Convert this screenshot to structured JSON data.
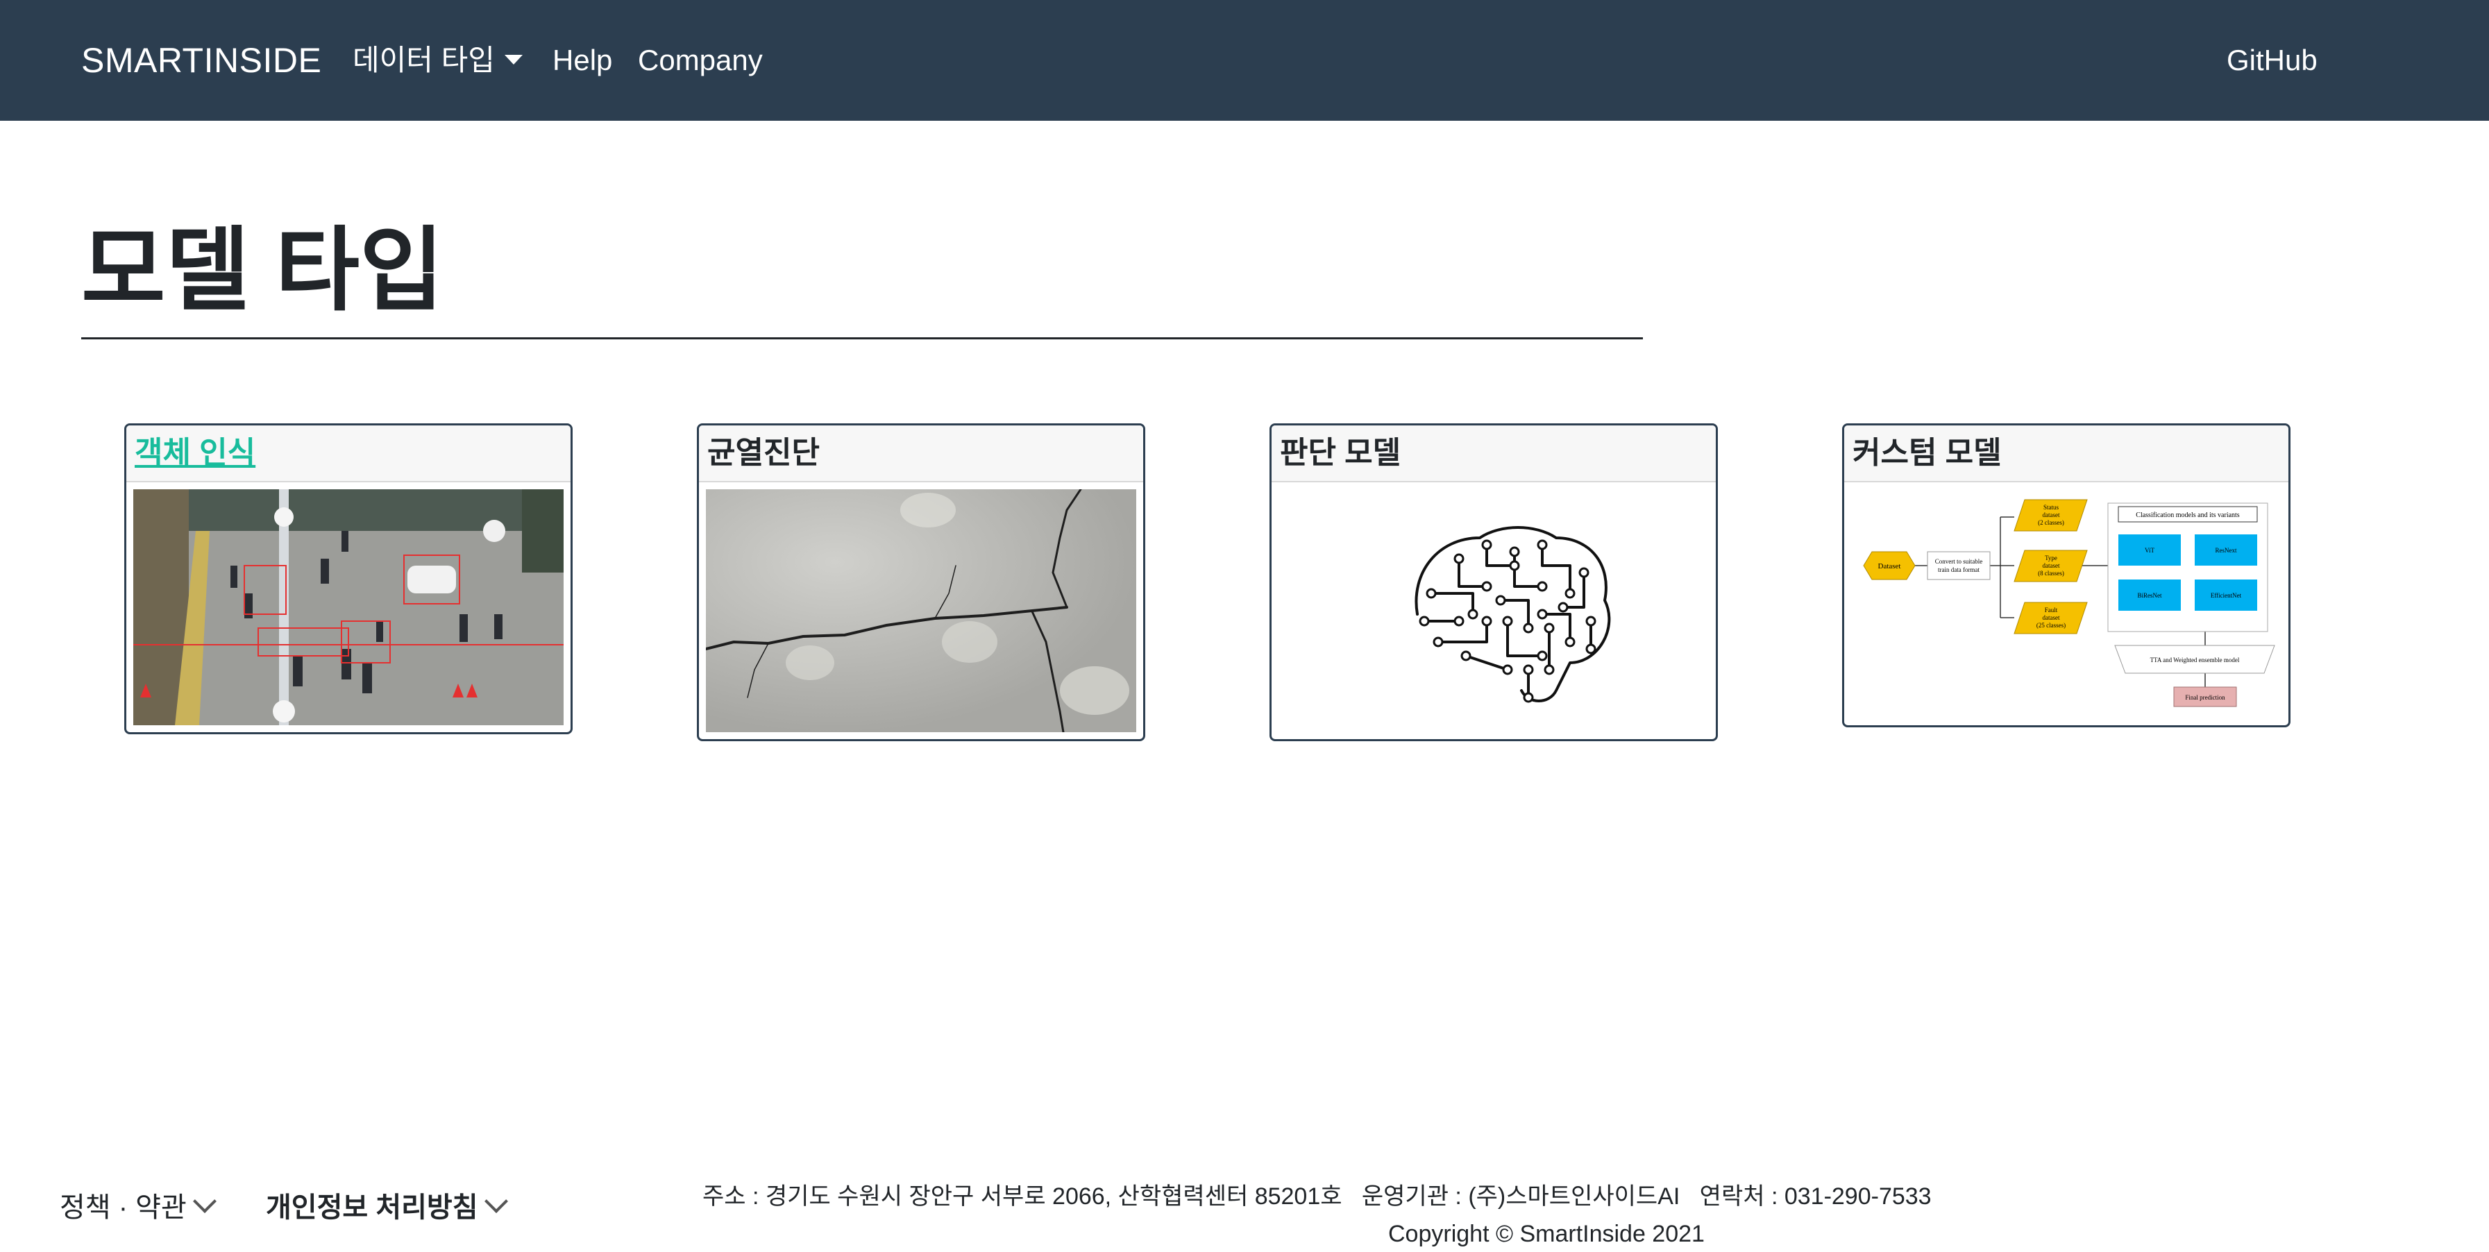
{
  "navbar": {
    "brand": "SMARTINSIDE",
    "dropdown_label": "데이터 타입",
    "help": "Help",
    "company": "Company",
    "github": "GitHub"
  },
  "page": {
    "title": "모델 타입"
  },
  "cards": [
    {
      "title": "객체 인식",
      "image": "object-detection-street-photo"
    },
    {
      "title": "균열진단",
      "image": "concrete-crack-photo"
    },
    {
      "title": "판단 모델",
      "image": "circuit-brain-icon"
    },
    {
      "title": "커스텀 모델",
      "image": "classification-pipeline-diagram"
    }
  ],
  "diagram": {
    "dataset": "Dataset",
    "convert": [
      "Convert to suitable",
      "train data format"
    ],
    "status": [
      "Status",
      "dataset",
      "(2 classes)"
    ],
    "type": [
      "Type",
      "dataset",
      "(8 classes)"
    ],
    "fault": [
      "Fault",
      "dataset",
      "(25 classes)"
    ],
    "models_title": "Classification models and its variants",
    "models": [
      "ViT",
      "ResNext",
      "BiResNet",
      "EfficientNet"
    ],
    "ensemble": "TTA and Weighted ensemble model",
    "final": "Final prediction"
  },
  "footer": {
    "policy": "정책 · 약관",
    "privacy": "개인정보 처리방침",
    "address": "주소 : 경기도 수원시 장안구 서부로 2066, 산학협력센터 85201호   운영기관 : (주)스마트인사이드AI   연락처 : 031-290-7533",
    "copyright": "Copyright © SmartInside 2021"
  },
  "colors": {
    "navbar_bg": "#2c3e50",
    "link_accent": "#18bc9c",
    "diagram_yellow": "#f5c000",
    "diagram_blue": "#00b0f0",
    "diagram_pink": "#e6b0b0"
  }
}
